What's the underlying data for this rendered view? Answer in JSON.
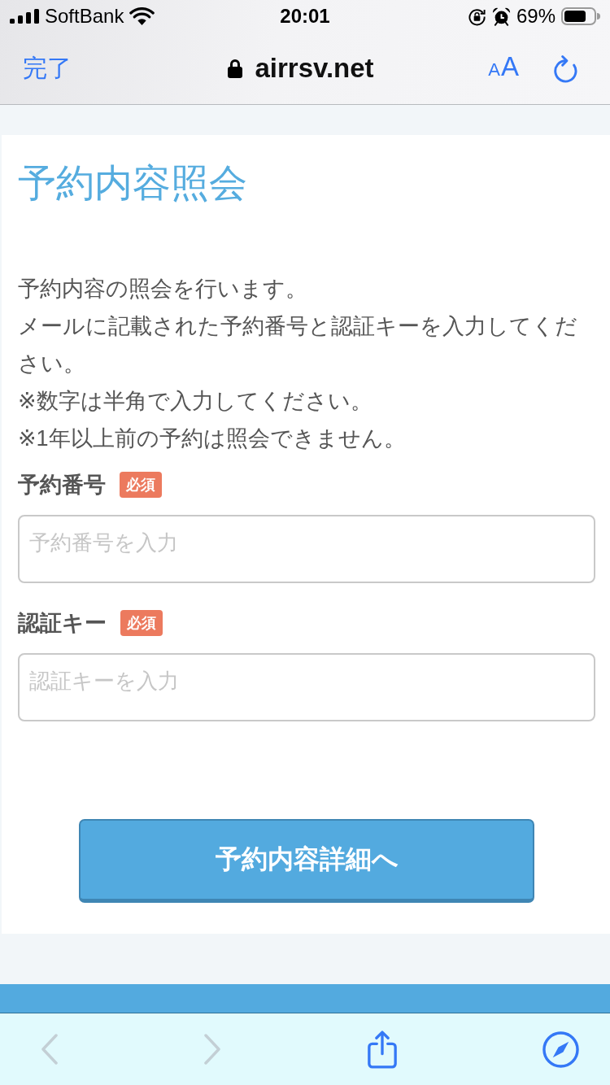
{
  "status_bar": {
    "carrier": "SoftBank",
    "time": "20:01",
    "battery": "69%"
  },
  "browser_bar": {
    "done": "完了",
    "url": "airrsv.net",
    "text_size": "AA"
  },
  "page": {
    "title": "予約内容照会",
    "intro": [
      "予約内容の照会を行います。",
      "メールに記載された予約番号と認証キーを入力してください。",
      "※数字は半角で入力してください。",
      "※1年以上前の予約は照会できません。"
    ],
    "fields": [
      {
        "label": "予約番号",
        "badge": "必須",
        "placeholder": "予約番号を入力"
      },
      {
        "label": "認証キー",
        "badge": "必須",
        "placeholder": "認証キーを入力"
      }
    ],
    "submit": "予約内容詳細へ"
  },
  "toolbar": [
    {
      "kind": "back",
      "disabled": true
    },
    {
      "kind": "forward",
      "disabled": true
    },
    {
      "kind": "share",
      "disabled": false
    },
    {
      "kind": "compass",
      "disabled": false
    }
  ]
}
